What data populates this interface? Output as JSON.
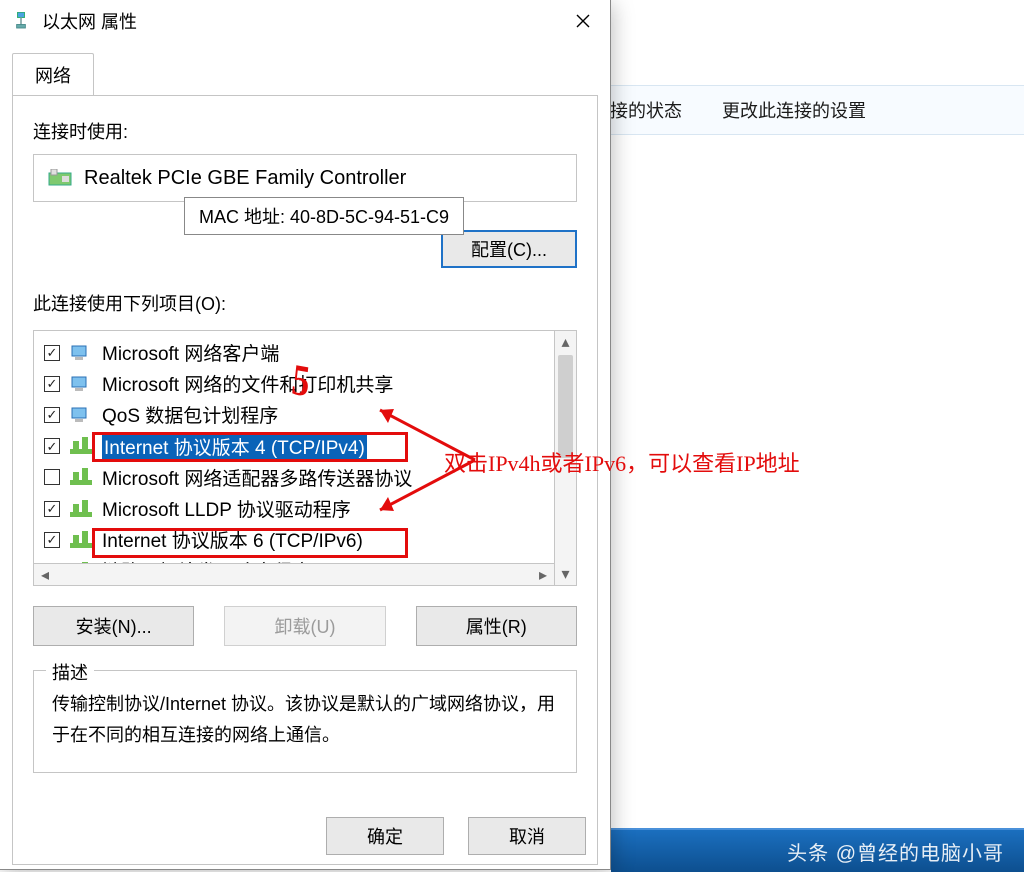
{
  "bg": {
    "toolbar_item1": "接的状态",
    "toolbar_item2": "更改此连接的设置",
    "watermark": "头条 @曾经的电脑小哥"
  },
  "dialog": {
    "title": "以太网 属性",
    "tab_network": "网络",
    "connect_using": "连接时使用:",
    "adapter_name": "Realtek PCIe GBE Family Controller",
    "tooltip": "MAC 地址: 40-8D-5C-94-51-C9",
    "configure_btn": "配置(C)...",
    "items_label": "此连接使用下列项目(O):",
    "items": [
      {
        "checked": true,
        "icon": "client",
        "text": "Microsoft 网络客户端",
        "selected": false
      },
      {
        "checked": true,
        "icon": "client",
        "text": "Microsoft 网络的文件和打印机共享",
        "selected": false
      },
      {
        "checked": true,
        "icon": "client",
        "text": "QoS 数据包计划程序",
        "selected": false
      },
      {
        "checked": true,
        "icon": "proto",
        "text": "Internet 协议版本 4 (TCP/IPv4)",
        "selected": true
      },
      {
        "checked": false,
        "icon": "proto",
        "text": "Microsoft 网络适配器多路传送器协议",
        "selected": false
      },
      {
        "checked": true,
        "icon": "proto",
        "text": "Microsoft LLDP 协议驱动程序",
        "selected": false
      },
      {
        "checked": true,
        "icon": "proto",
        "text": "Internet 协议版本 6 (TCP/IPv6)",
        "selected": false
      },
      {
        "checked": true,
        "icon": "proto",
        "text": "链路层拓补发现响应程序",
        "selected": false
      }
    ],
    "install_btn": "安装(N)...",
    "uninstall_btn": "卸载(U)",
    "properties_btn": "属性(R)",
    "desc_legend": "描述",
    "desc_text": "传输控制协议/Internet 协议。该协议是默认的广域网络协议，用于在不同的相互连接的网络上通信。",
    "ok_btn": "确定",
    "cancel_btn": "取消"
  },
  "annotation": {
    "five": "5",
    "note": "双击IPv4h或者IPv6，可以查看IP地址"
  }
}
